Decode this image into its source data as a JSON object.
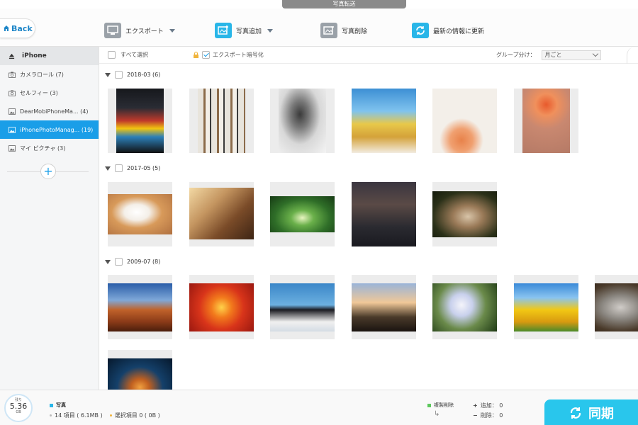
{
  "window": {
    "title": "写真転送"
  },
  "toolbar": {
    "back_label": "Back",
    "export_label": "エクスポート",
    "add_label": "写真追加",
    "delete_label": "写真削除",
    "refresh_label": "最新の情報に更新",
    "accent": "#29c6ec"
  },
  "sidebar": {
    "device": "iPhone",
    "items": [
      {
        "label": "カメラロール (7)",
        "icon": "camera-icon"
      },
      {
        "label": "セルフィー (3)",
        "icon": "camera-icon"
      },
      {
        "label": "DearMobiPhoneMa... (4)",
        "icon": "album-icon"
      },
      {
        "label": "iPhonePhotoManag... (19)",
        "icon": "album-icon"
      },
      {
        "label": "マイ ピクチャ (3)",
        "icon": "album-icon"
      }
    ],
    "active_index": 3,
    "add_label": "+"
  },
  "filter": {
    "select_all": "すべて選択",
    "encrypt_export": "エクスポート暗号化",
    "group_label": "グループ分け：",
    "group_value": "月ごと"
  },
  "groups": [
    {
      "label": "2018-03 (6)",
      "photos": [
        "woman-colorful-outfit",
        "wall-of-photos",
        "dancer-bw",
        "woman-floral-dress",
        "palm-tree-flowers",
        "flowers-on-legs"
      ]
    },
    {
      "label": "2017-05 (5)",
      "photos": [
        "white-kitten",
        "piano-room",
        "tree-tunnel-road",
        "night-street",
        "squirrel"
      ]
    },
    {
      "label": "2009-07 (8)",
      "photos": [
        "desert",
        "chrysanthemum",
        "penguins",
        "lighthouse",
        "hydrangeas",
        "tulips",
        "koala",
        "jellyfish"
      ]
    }
  ],
  "footer": {
    "storage_label": "残り",
    "storage_value": "5.36",
    "storage_unit": "GB",
    "category": "写真",
    "items_text": "14 項目 ( 6.1MB )",
    "selected_text": "選択項目 0 ( 0B )",
    "delete_label": "複製削除",
    "added_text": "追加： 0",
    "removed_text": "削除： 0",
    "sync_label": "同期"
  }
}
